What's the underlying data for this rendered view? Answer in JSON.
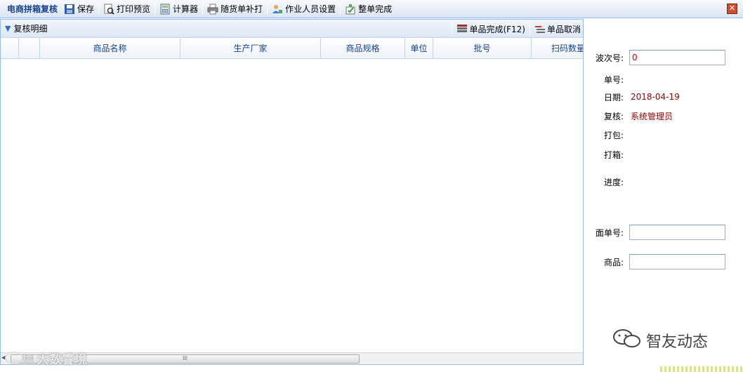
{
  "toolbar": {
    "title": "电商拼箱复核",
    "buttons": [
      {
        "label": "保存",
        "icon": "save-icon"
      },
      {
        "label": "打印预览",
        "icon": "print-preview-icon"
      },
      {
        "label": "计算器",
        "icon": "calculator-icon"
      },
      {
        "label": "随货单补打",
        "icon": "printer-icon"
      },
      {
        "label": "作业人员设置",
        "icon": "user-settings-icon"
      },
      {
        "label": "整单完成",
        "icon": "complete-order-icon"
      }
    ]
  },
  "grid": {
    "panel_title": "复核明细",
    "actions": [
      {
        "label": "单品完成(F12)",
        "icon": "item-complete-icon"
      },
      {
        "label": "单品取消",
        "icon": "item-cancel-icon"
      }
    ],
    "columns": [
      "",
      "",
      "商品名称",
      "生产厂家",
      "商品规格",
      "单位",
      "批号",
      "扫码数量"
    ],
    "rows": [],
    "scrollbar_grip": "III"
  },
  "form": {
    "wave_label": "波次号:",
    "wave_value": "0",
    "order_label": "单号:",
    "order_value": "",
    "date_label": "日期:",
    "date_value": "2018-04-19",
    "review_label": "复核:",
    "review_value": "系统管理员",
    "pack_label": "打包:",
    "pack_value": "",
    "box_label": "打箱:",
    "box_value": "",
    "progress_label": "进度:",
    "progress_value": "",
    "waybill_label": "面单号:",
    "waybill_value": "",
    "goods_label": "商品:",
    "goods_value": ""
  },
  "watermarks": {
    "left": "大数睿境",
    "right": "智友动态"
  }
}
